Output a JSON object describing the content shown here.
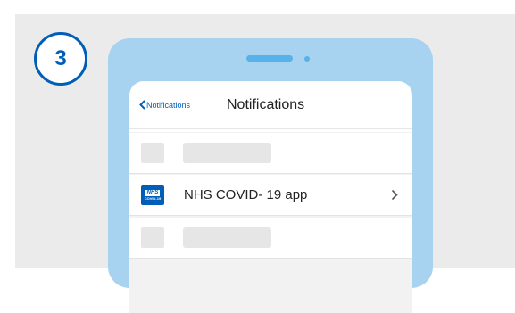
{
  "step": {
    "number": "3"
  },
  "nav": {
    "back_label": "Notifications",
    "title": "Notifications"
  },
  "list": {
    "app_row": {
      "icon": {
        "logo_text": "NHS",
        "sub_text": "COVID-19",
        "name": "nhs-covid-app-icon"
      },
      "label": "NHS COVID- 19 app"
    }
  },
  "colors": {
    "nhs_blue": "#005eb8",
    "phone_body": "#a7d3f0",
    "panel_bg": "#ebebeb"
  }
}
